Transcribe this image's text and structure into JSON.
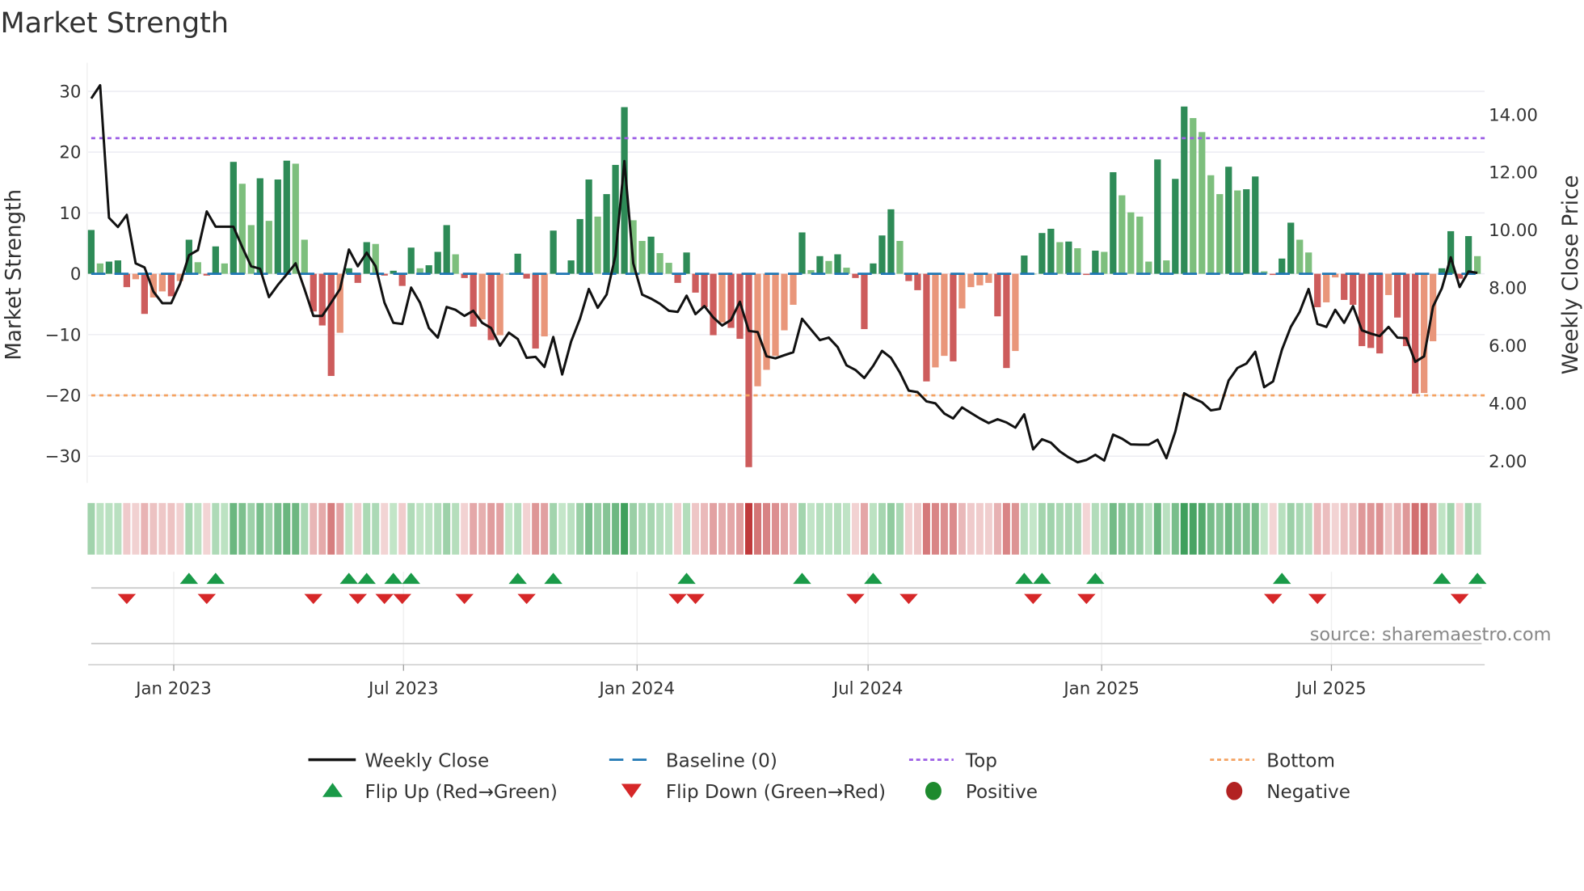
{
  "title": "Market Strength",
  "source": "source: sharemaestro.com",
  "colors": {
    "pos_rising": "#2e8b57",
    "pos_falling": "#7dbf7d",
    "neg_falling": "#cd5c5c",
    "neg_rising": "#e9967a",
    "baseline": "#1f77b4",
    "top": "#9b5de5",
    "bottom": "#f4a261",
    "close": "#111111",
    "flip_up": "#1a9a48",
    "flip_down": "#d62728",
    "positive": "#1e8a2e",
    "negative": "#b22222"
  },
  "legend": [
    {
      "key": "close",
      "label": "Weekly Close"
    },
    {
      "key": "baseline",
      "label": "Baseline (0)"
    },
    {
      "key": "top",
      "label": "Top"
    },
    {
      "key": "bottom",
      "label": "Bottom"
    },
    {
      "key": "flip_up",
      "label": "Flip Up (Red→Green)"
    },
    {
      "key": "flip_down",
      "label": "Flip Down (Green→Red)"
    },
    {
      "key": "positive",
      "label": "Positive"
    },
    {
      "key": "negative",
      "label": "Negative"
    }
  ],
  "chart_data": {
    "type": "bar+line",
    "title": "Market Strength",
    "ylabel": "Market Strength",
    "y2label": "Weekly Close Price",
    "ylim": [
      -33,
      32
    ],
    "y2lim": [
      1.1,
      15.3
    ],
    "yticks": [
      "30",
      "20",
      "10",
      "0",
      "−10",
      "−20",
      "−30"
    ],
    "ytick_values": [
      30,
      20,
      10,
      0,
      -10,
      -20,
      -30
    ],
    "y2ticks": [
      "14.00",
      "12.00",
      "10.00",
      "8.00",
      "6.00",
      "4.00",
      "2.00"
    ],
    "y2tick_values": [
      14,
      12,
      10,
      8,
      6,
      4,
      2
    ],
    "xticks": [
      {
        "label": "Jan 2023",
        "date": "2023-01-01"
      },
      {
        "label": "Jul 2023",
        "date": "2023-07-01"
      },
      {
        "label": "Jan 2024",
        "date": "2024-01-01"
      },
      {
        "label": "Jul 2024",
        "date": "2024-07-01"
      },
      {
        "label": "Jan 2025",
        "date": "2025-01-01"
      },
      {
        "label": "Jul 2025",
        "date": "2025-07-01"
      }
    ],
    "start_date": "2022-10-28",
    "frequency": "weekly",
    "top_level": 22.3,
    "bottom_level": -20,
    "baseline": 0,
    "strength": [
      7.2,
      1.7,
      2,
      2.2,
      -2.2,
      -0.9,
      -6.6,
      -3.9,
      -2.9,
      -3.7,
      -1.2,
      5.6,
      1.9,
      -0.3,
      4.5,
      1.7,
      18.4,
      14.8,
      8,
      15.7,
      8.7,
      15.5,
      18.6,
      18.1,
      5.6,
      -6.2,
      -8.5,
      -16.8,
      -9.7,
      0.9,
      -1.5,
      5.2,
      4.9,
      -0.3,
      0.5,
      -2,
      4.3,
      0.9,
      1.4,
      3.6,
      8,
      3.2,
      -0.7,
      -8.7,
      -7.5,
      -10.9,
      -10.1,
      0,
      3.3,
      -0.8,
      -12.3,
      -10.3,
      7.1,
      0,
      2.2,
      9,
      15.5,
      9.4,
      13.1,
      17.9,
      27.4,
      8.8,
      5.4,
      6.1,
      3.4,
      1.8,
      -1.5,
      3.5,
      -3.1,
      -5.5,
      -10.1,
      -8,
      -8.9,
      -10.7,
      -31.8,
      -18.5,
      -15.8,
      -13.5,
      -9.3,
      -5.1,
      6.8,
      0.6,
      2.9,
      2.1,
      3.2,
      1,
      -0.7,
      -9.1,
      1.7,
      6.3,
      10.6,
      5.4,
      -1.2,
      -2.7,
      -17.7,
      -15.4,
      -13.5,
      -14.4,
      -5.7,
      -2.2,
      -1.9,
      -1.5,
      -7,
      -15.5,
      -12.7,
      3,
      0,
      6.7,
      7.4,
      5.2,
      5.3,
      4.2,
      -0.2,
      3.8,
      3.6,
      16.7,
      12.9,
      10.1,
      9.4,
      2,
      18.8,
      2.2,
      15.6,
      27.5,
      25.6,
      23.3,
      16.2,
      13.1,
      17.6,
      13.7,
      13.9,
      16,
      0.4,
      -0.2,
      2.5,
      8.4,
      5.6,
      3.5,
      -5.5,
      -4.7,
      -0.6,
      -4.3,
      -5.1,
      -11.9,
      -12.2,
      -13.1,
      -3.5,
      -7.2,
      -11.9,
      -19.7,
      -19.6,
      -11.1,
      0.9,
      7,
      -0.8,
      6.2,
      2.9
    ],
    "weekly_close": [
      14.56,
      15.02,
      10.43,
      10.11,
      10.53,
      8.85,
      8.71,
      7.87,
      7.47,
      7.47,
      8.15,
      9.13,
      9.31,
      10.65,
      10.12,
      10.12,
      10.12,
      9.41,
      8.75,
      8.66,
      7.68,
      8.1,
      8.47,
      8.85,
      7.96,
      7.03,
      7.03,
      7.49,
      7.96,
      9.33,
      8.75,
      9.22,
      8.75,
      7.49,
      6.79,
      6.75,
      8.01,
      7.49,
      6.61,
      6.28,
      7.34,
      7.24,
      7.03,
      7.21,
      6.79,
      6.61,
      6.0,
      6.45,
      6.23,
      5.58,
      5.61,
      5.26,
      6.3,
      5.0,
      6.14,
      6.93,
      7.96,
      7.31,
      7.77,
      9.13,
      12.39,
      8.85,
      7.77,
      7.63,
      7.45,
      7.21,
      7.17,
      7.73,
      7.09,
      7.37,
      6.98,
      6.7,
      6.89,
      7.52,
      6.51,
      6.47,
      5.63,
      5.56,
      5.67,
      5.77,
      6.93,
      6.56,
      6.19,
      6.28,
      5.95,
      5.32,
      5.16,
      4.88,
      5.3,
      5.82,
      5.58,
      5.07,
      4.44,
      4.39,
      4.07,
      4.0,
      3.65,
      3.48,
      3.86,
      3.67,
      3.48,
      3.32,
      3.45,
      3.34,
      3.16,
      3.62,
      2.41,
      2.76,
      2.64,
      2.34,
      2.13,
      1.96,
      2.04,
      2.22,
      2.02,
      2.92,
      2.78,
      2.58,
      2.57,
      2.57,
      2.74,
      2.1,
      3.02,
      4.35,
      4.18,
      4.04,
      3.76,
      3.81,
      4.79,
      5.23,
      5.38,
      5.79,
      4.56,
      4.76,
      5.86,
      6.65,
      7.17,
      7.96,
      6.75,
      6.65,
      7.24,
      6.79,
      7.37,
      6.53,
      6.42,
      6.33,
      6.65,
      6.28,
      6.26,
      5.44,
      5.63,
      7.35,
      7.99,
      9.06,
      8.03,
      8.57,
      8.52
    ],
    "flip_up_weeks": [
      11,
      14,
      29,
      31,
      34,
      36,
      48,
      52,
      67,
      80,
      88,
      105,
      107,
      113,
      134,
      152,
      156
    ],
    "flip_down_weeks": [
      4,
      13,
      25,
      30,
      33,
      35,
      42,
      49,
      66,
      68,
      86,
      92,
      106,
      112,
      133,
      138,
      154
    ],
    "legend_position": "bottom"
  }
}
